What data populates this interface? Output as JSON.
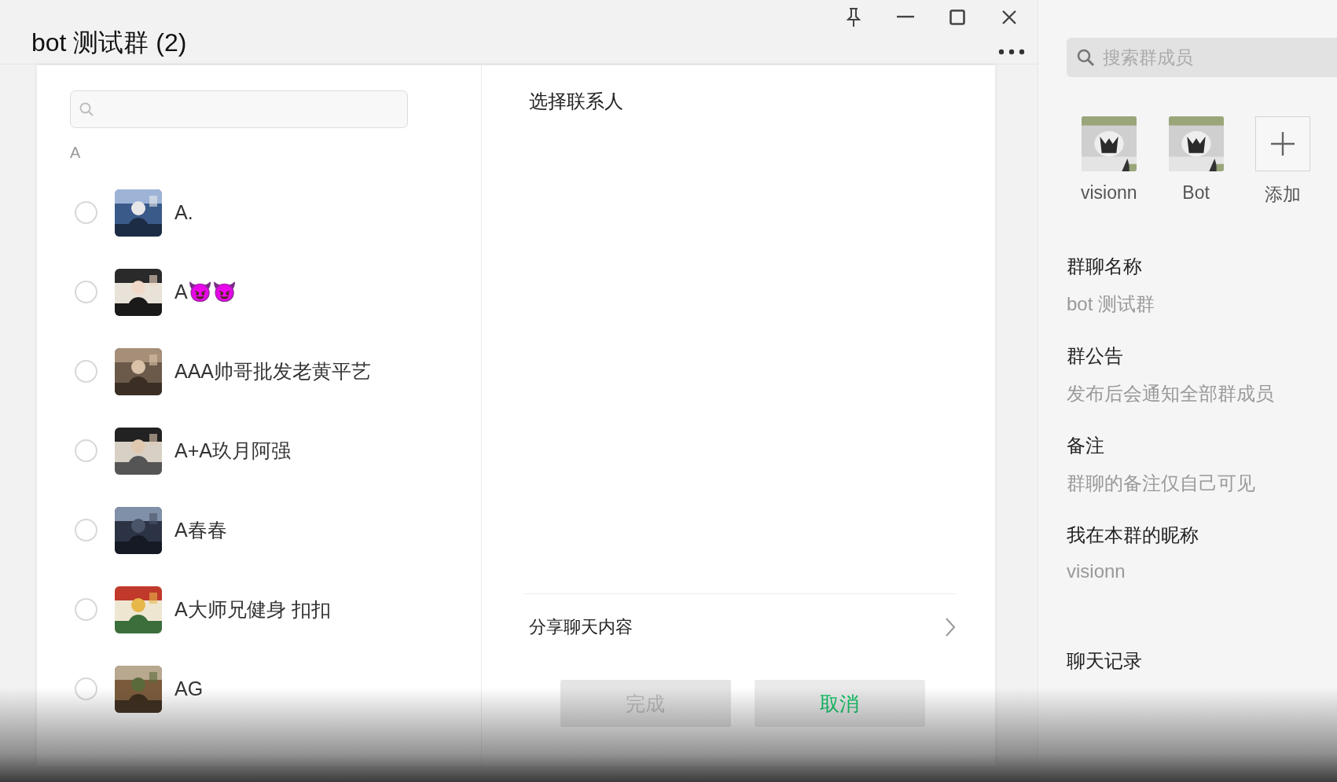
{
  "window": {
    "title": "bot 测试群 (2)"
  },
  "dialog": {
    "section_letter": "A",
    "contacts": [
      {
        "name": "A.",
        "selected": false
      },
      {
        "name": "A😈😈",
        "selected": false
      },
      {
        "name": "AAA帅哥批发老黄平艺",
        "selected": false
      },
      {
        "name": "A+A玖月阿强",
        "selected": false
      },
      {
        "name": "A春春",
        "selected": false
      },
      {
        "name": "A大师兄健身 扣扣",
        "selected": false
      },
      {
        "name": "AG",
        "selected": false
      }
    ],
    "selected_header": "选择联系人",
    "share": {
      "label": "分享聊天内容"
    },
    "buttons": [
      {
        "label": "完成",
        "kind": "confirm",
        "disabled": true
      },
      {
        "label": "取消",
        "kind": "cancel",
        "disabled": false
      }
    ]
  },
  "side_panel": {
    "search": {
      "placeholder": "搜索群成员"
    },
    "members": [
      {
        "name": "visionn",
        "kind": "member"
      },
      {
        "name": "Bot",
        "kind": "member"
      },
      {
        "name": "添加",
        "kind": "add"
      }
    ],
    "fields": [
      {
        "label": "群聊名称",
        "value": "bot 测试群"
      },
      {
        "label": "群公告",
        "value": "发布后会通知全部群成员"
      },
      {
        "label": "备注",
        "value": "群聊的备注仅自己可见"
      },
      {
        "label": "我在本群的昵称",
        "value": "visionn"
      },
      {
        "label": "聊天记录"
      }
    ]
  }
}
